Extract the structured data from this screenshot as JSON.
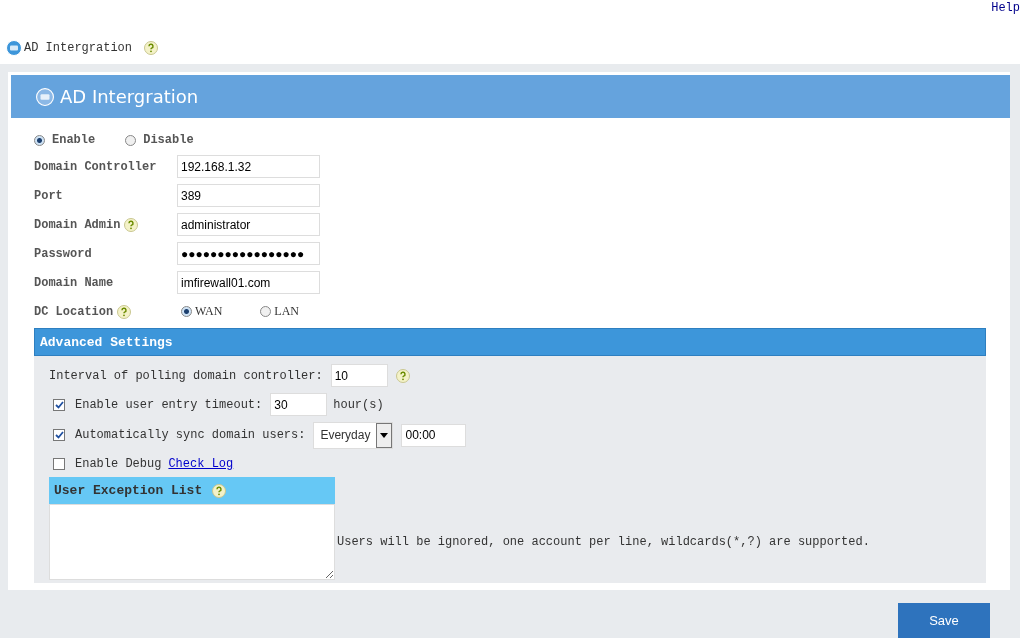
{
  "help_link": "Help",
  "breadcrumb": {
    "title": "AD Intergration"
  },
  "panel": {
    "title": "AD Intergration"
  },
  "status": [
    {
      "label": "Enable",
      "selected": true
    },
    {
      "label": "Disable",
      "selected": false
    }
  ],
  "fields": [
    {
      "label": "Domain Controller",
      "value": "192.168.1.32",
      "help": false
    },
    {
      "label": "Port",
      "value": "389",
      "help": false
    },
    {
      "label": "Domain Admin",
      "value": "administrator",
      "help": true
    },
    {
      "label": "Password",
      "value": "●●●●●●●●●●●●●●●●●",
      "help": false
    },
    {
      "label": "Domain Name",
      "value": "imfirewall01.com",
      "help": false
    }
  ],
  "dc_location": {
    "label": "DC Location",
    "options": [
      {
        "label": "WAN",
        "selected": true
      },
      {
        "label": "LAN",
        "selected": false
      }
    ]
  },
  "advanced": {
    "title": "Advanced Settings",
    "polling": {
      "label": "Interval of polling domain controller:",
      "value": "10"
    },
    "timeout": {
      "label": "Enable user entry timeout:",
      "checked": true,
      "value": "30",
      "unit": "hour(s)"
    },
    "sync": {
      "label": "Automatically sync domain users:",
      "checked": true,
      "frequency": "Everyday",
      "time": "00:00"
    },
    "debug": {
      "label": "Enable Debug",
      "checked": false,
      "link": "Check Log"
    },
    "exception_list": {
      "title": "User Exception List",
      "hint": "Users will be ignored, one account per line, wildcards(*,?) are supported."
    }
  },
  "buttons": [
    {
      "label": "Save"
    }
  ]
}
